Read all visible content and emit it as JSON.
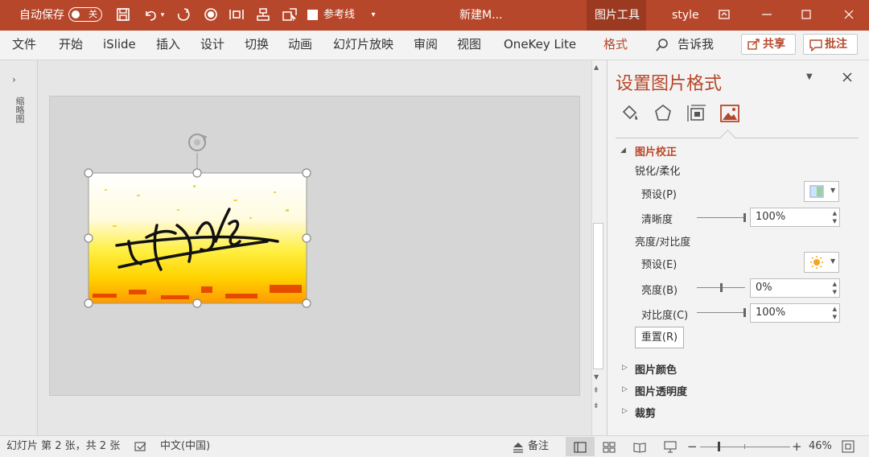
{
  "title_bar": {
    "autosave_label": "自动保存",
    "autosave_state": "关",
    "ruler_checkbox_label": "参考线",
    "doc_title": "新建M...",
    "context_tab": "图片工具",
    "user_name": "style",
    "accent_color": "#b7472a"
  },
  "ribbon": {
    "tabs": [
      "文件",
      "开始",
      "iSlide",
      "插入",
      "设计",
      "切换",
      "动画",
      "幻灯片放映",
      "审阅",
      "视图",
      "OneKey Lite",
      "格式"
    ],
    "active_tab": "格式",
    "tell_me": "告诉我",
    "share_label": "共享",
    "comment_label": "批注"
  },
  "left_panel": {
    "label": "缩略图"
  },
  "format_pane": {
    "title": "设置图片格式",
    "sections": {
      "correction": "图片校正",
      "sharpen_soften": "锐化/柔化",
      "preset_sharpen": "预设(P)",
      "clarity_label": "清晰度",
      "clarity_value": "100%",
      "brightness_contrast": "亮度/对比度",
      "preset_brightness": "预设(E)",
      "brightness_label": "亮度(B)",
      "brightness_value": "0%",
      "contrast_label": "对比度(C)",
      "contrast_value": "100%",
      "reset_button": "重置(R)",
      "color": "图片颜色",
      "transparency": "图片透明度",
      "crop": "裁剪"
    }
  },
  "status_bar": {
    "slide_info": "幻灯片 第 2 张，共 2 张",
    "language": "中文(中国)",
    "notes": "备注",
    "zoom": "46%"
  }
}
